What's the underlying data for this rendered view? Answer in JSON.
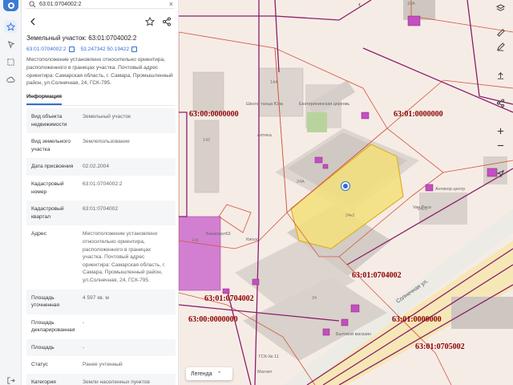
{
  "search": {
    "value": "63:01:0704002:2"
  },
  "header": {
    "title": "Земельный участок: 63:01:0704002:2",
    "cadastral_number": "63:01:0704002:2",
    "coordinates": "53.247342 50.19422",
    "address": "Местоположение установлено относительно ориентира, расположенного в границах участка. Почтовый адрес ориентира: Самарская область, г. Самара, Промышленный район, ул.Солнечная, 24, ГСК-795."
  },
  "tabs": {
    "info": "Информация"
  },
  "info_rows": [
    {
      "key": "Вид объекта недвижимости",
      "value": "Земельный участок"
    },
    {
      "key": "Вид земельного участка",
      "value": "Землепользование"
    },
    {
      "key": "Дата присвоения",
      "value": "02.02.2004"
    },
    {
      "key": "Кадастровый номер",
      "value": "63:01:0704002:2"
    },
    {
      "key": "Кадастровый квартал",
      "value": "63:01:0704002"
    },
    {
      "key": "Адрес",
      "value": "Местоположение установлено относительно ориентира, расположенного в границах участка. Почтовый адрес ориентира: Самарская область, г. Самара, Промышленный район, ул.Солнечная, 24, ГСК-795."
    },
    {
      "key": "Площадь уточненная",
      "value": "4 597 кв. м"
    },
    {
      "key": "Площадь декларированная",
      "value": "-"
    },
    {
      "key": "Площадь",
      "value": "-"
    },
    {
      "key": "Статус",
      "value": "Ранее учтенный"
    },
    {
      "key": "Категория",
      "value": "Земли населенных пунктов"
    }
  ],
  "map": {
    "cadastral_labels": {
      "a": "63:00:0000000",
      "b": "63:01:0000000",
      "c": "63:01:0704002",
      "d": "63:01:0704002",
      "e": "63:00:0000000",
      "f": "63:01:0000000",
      "g": "63:01:0705002"
    },
    "pois": {
      "school": "Школа танца Юла",
      "church": "Екатерининская церковь",
      "pharmacy": "Аптека",
      "antikor": "Антикор центр",
      "vaypace": "Vay Pace",
      "bankomat": "Банкомат63",
      "kiosk": "Киоск",
      "gsk": "ГСК-№ 11",
      "magnit": "Магнит",
      "store": "Бытовой магазин"
    },
    "building_numbers": {
      "b144": "144",
      "b142": "142",
      "b24a": "24А",
      "b24k2": "24к2",
      "b24k1": "24с1",
      "b146": "146",
      "b24": "24",
      "b10a": "10А"
    },
    "street": "Солнечная ул.",
    "legend_label": "Легенда"
  },
  "colors": {
    "accent": "#2f6fd1",
    "parcel": "#f3e07a",
    "boundary_red": "#d2553d",
    "boundary_purple": "#8b1e6b"
  }
}
